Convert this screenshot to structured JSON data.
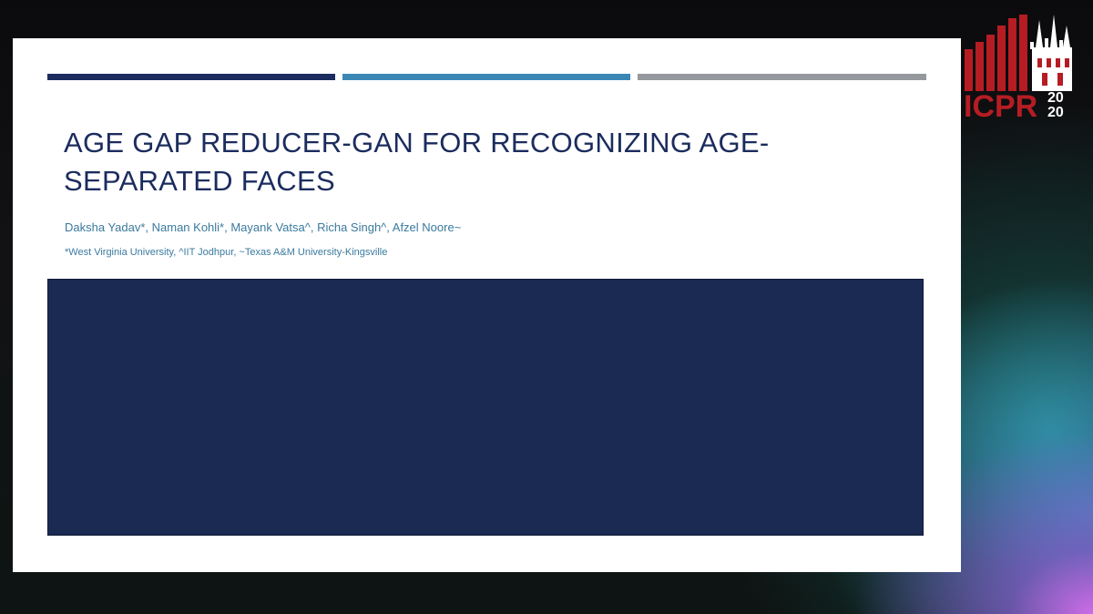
{
  "slide": {
    "title_line1": "AGE GAP REDUCER-GAN FOR RECOGNIZING AGE-",
    "title_line2": "SEPARATED FACES",
    "authors": "Daksha Yadav*, Naman Kohli*, Mayank Vatsa^, Richa Singh^, Afzel Noore~",
    "affiliations": "*West Virginia University, ^IIT Jodhpur, ~Texas A&M University-Kingsville"
  },
  "logo": {
    "text": "ICPR",
    "year_top": "20",
    "year_bottom": "20",
    "icon": "icpr-2020-logo",
    "colors": {
      "red": "#b51d23",
      "white": "#ffffff"
    }
  },
  "colors": {
    "navy": "#1b2c5e",
    "blue": "#3a87b5",
    "gray": "#95989d",
    "content_box": "#1b2a52",
    "subtitle": "#3a7a9e"
  }
}
